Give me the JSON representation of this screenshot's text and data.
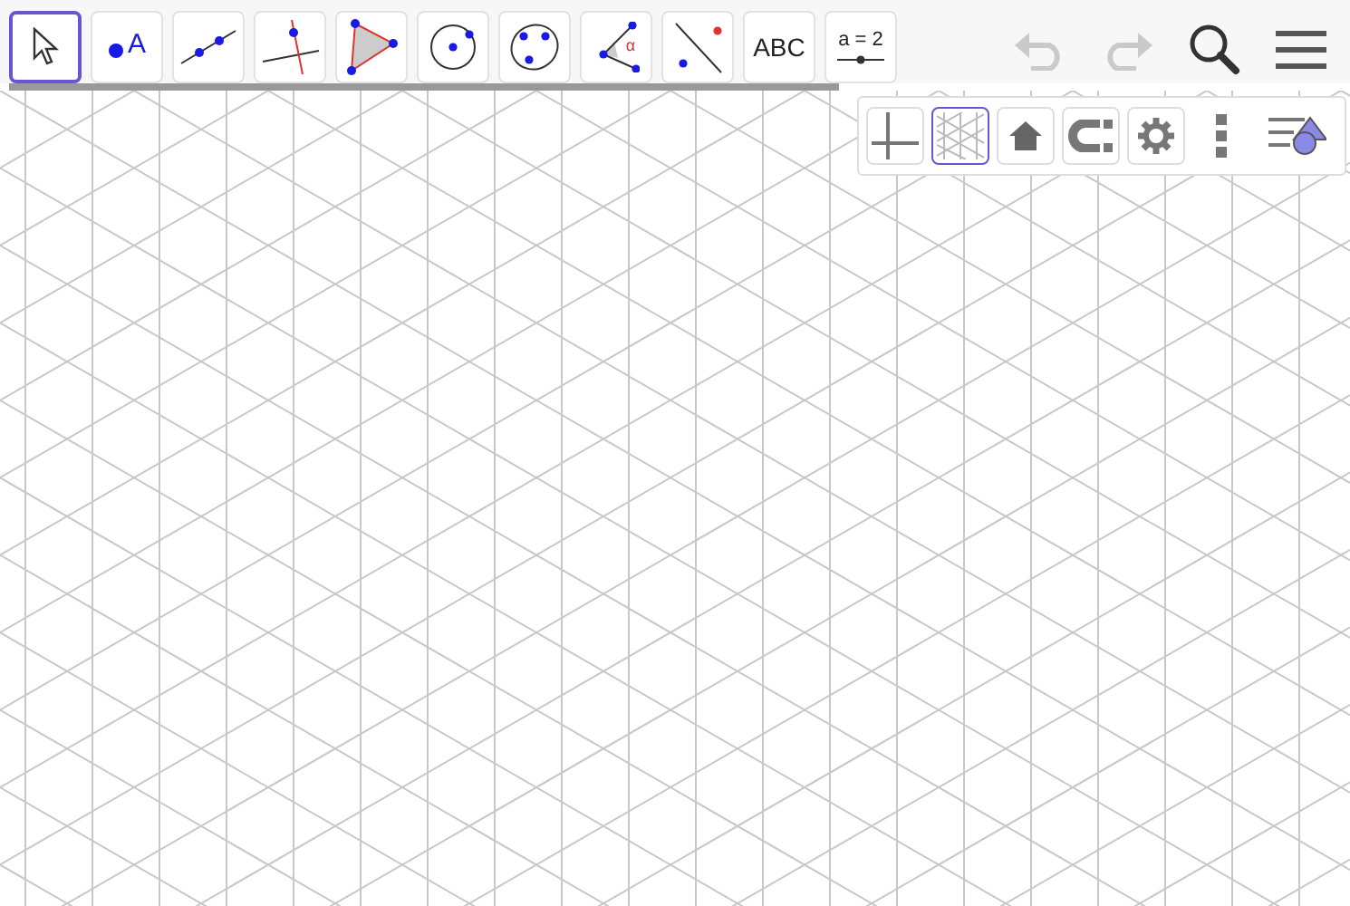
{
  "toolbar": {
    "tools": [
      {
        "kind": "move",
        "selected": true
      },
      {
        "kind": "point",
        "selected": false,
        "label": "A"
      },
      {
        "kind": "line",
        "selected": false
      },
      {
        "kind": "perpendicular",
        "selected": false
      },
      {
        "kind": "polygon",
        "selected": false
      },
      {
        "kind": "circle",
        "selected": false
      },
      {
        "kind": "ellipse",
        "selected": false
      },
      {
        "kind": "angle",
        "selected": false,
        "label": "α"
      },
      {
        "kind": "reflect",
        "selected": false
      },
      {
        "kind": "text",
        "selected": false,
        "label": "ABC"
      },
      {
        "kind": "slider",
        "selected": false,
        "label": "a = 2"
      }
    ],
    "actions": [
      {
        "kind": "undo",
        "disabled": true
      },
      {
        "kind": "redo",
        "disabled": true
      },
      {
        "kind": "search",
        "disabled": false
      },
      {
        "kind": "menu",
        "disabled": false
      }
    ]
  },
  "style_bar": {
    "buttons": [
      {
        "kind": "axes",
        "selected": false
      },
      {
        "kind": "grid",
        "selected": true
      },
      {
        "kind": "home",
        "selected": false
      },
      {
        "kind": "magnet",
        "selected": false
      },
      {
        "kind": "gear",
        "selected": false
      },
      {
        "kind": "more"
      },
      {
        "kind": "toggle"
      }
    ]
  }
}
